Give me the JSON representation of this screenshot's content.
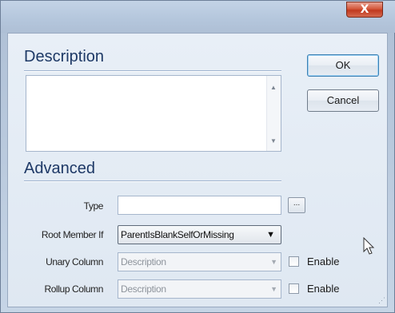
{
  "window": {
    "close_glyph": "X"
  },
  "description": {
    "title": "Description",
    "text": ""
  },
  "buttons": {
    "ok": "OK",
    "cancel": "Cancel"
  },
  "advanced": {
    "title": "Advanced",
    "type_label": "Type",
    "type_value": "",
    "browse_label": "...",
    "root_member_label": "Root Member If",
    "root_member_value": "ParentIsBlankSelfOrMissing",
    "unary_label": "Unary Column",
    "unary_value": "Description",
    "unary_enable": "Enable",
    "rollup_label": "Rollup Column",
    "rollup_value": "Description",
    "rollup_enable": "Enable"
  },
  "icons": {
    "close": "close-icon",
    "scroll_up": "chevron-up-icon",
    "scroll_down": "chevron-down-icon",
    "dropdown": "chevron-down-icon",
    "cursor": "mouse-pointer-icon"
  },
  "colors": {
    "heading": "#1e3966",
    "close_button": "#c0391f",
    "client_bg": "#e8eff7"
  }
}
